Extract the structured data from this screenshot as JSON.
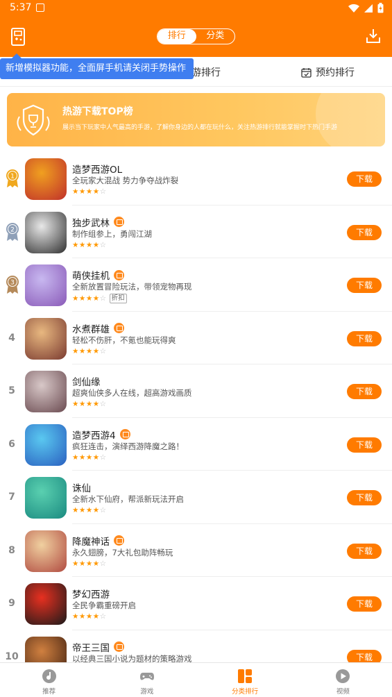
{
  "status_bar": {
    "time": "5:37"
  },
  "header": {
    "segments": [
      {
        "label": "排行",
        "active": true
      },
      {
        "label": "分类",
        "active": false
      }
    ]
  },
  "tabs": {
    "left_partial": "游排行",
    "right": "预约排行"
  },
  "tooltip": "新增模拟器功能，全面屏手机请关闭手势操作",
  "banner": {
    "title": "热游下载TOP榜",
    "desc": "展示当下玩家中人气最高的手游，了解你身边的人都在玩什么，关注热游排行就能掌握时下热门手游"
  },
  "download_label": "下载",
  "games": [
    {
      "rank": "1",
      "name": "造梦西游OL",
      "desc": "全玩家大混战 势力争夺战炸裂",
      "stars": 4,
      "gift": false,
      "tag": "",
      "colors": [
        "#f0a020",
        "#c0302a"
      ]
    },
    {
      "rank": "2",
      "name": "独步武林",
      "desc": "制作组参上，勇闯江湖",
      "stars": 4,
      "gift": true,
      "tag": "",
      "colors": [
        "#e8e8e8",
        "#303030"
      ]
    },
    {
      "rank": "3",
      "name": "萌侠挂机",
      "desc": "全新放置冒险玩法，带领宠物再现",
      "stars": 4,
      "gift": true,
      "tag": "折扣",
      "colors": [
        "#c8b8f0",
        "#8a5ab8"
      ]
    },
    {
      "rank": "4",
      "name": "水煮群雄",
      "desc": "轻松不伤肝，不氪也能玩得爽",
      "stars": 4,
      "gift": true,
      "tag": "",
      "colors": [
        "#e8b880",
        "#7a3a30"
      ]
    },
    {
      "rank": "5",
      "name": "剑仙缘",
      "desc": "超爽仙侠多人在线，超高游戏画质",
      "stars": 4,
      "gift": false,
      "tag": "",
      "colors": [
        "#d8c8c8",
        "#6a4a50"
      ]
    },
    {
      "rank": "6",
      "name": "造梦西游4",
      "desc": "疯狂连击，演绎西游降魔之路！",
      "stars": 4,
      "gift": true,
      "tag": "",
      "colors": [
        "#5ac8f0",
        "#2a60c0"
      ]
    },
    {
      "rank": "7",
      "name": "诛仙",
      "desc": "全新水下仙府，帮派新玩法开启",
      "stars": 4,
      "gift": false,
      "tag": "",
      "colors": [
        "#5ad0b0",
        "#1a8a80"
      ]
    },
    {
      "rank": "8",
      "name": "降魔神话",
      "desc": "永久翅膀，7大礼包助阵畅玩",
      "stars": 4,
      "gift": true,
      "tag": "",
      "colors": [
        "#f0d0a0",
        "#b04a40"
      ]
    },
    {
      "rank": "9",
      "name": "梦幻西游",
      "desc": "全民争霸重磅开启",
      "stars": 4,
      "gift": false,
      "tag": "",
      "colors": [
        "#e83020",
        "#1a1a1a"
      ]
    },
    {
      "rank": "10",
      "name": "帝王三国",
      "desc": "以经典三国小说为题材的策略游戏",
      "stars": 4,
      "gift": true,
      "tag": "",
      "colors": [
        "#d08040",
        "#402010"
      ]
    }
  ],
  "bottom_nav": [
    {
      "label": "推荐",
      "icon": "recommend-icon",
      "active": false
    },
    {
      "label": "游戏",
      "icon": "gamepad-icon",
      "active": false
    },
    {
      "label": "分类排行",
      "icon": "category-rank-icon",
      "active": true
    },
    {
      "label": "视频",
      "icon": "play-icon",
      "active": false
    }
  ],
  "colors": {
    "accent": "#ff7b00",
    "tooltip": "#3f7ef0",
    "gold": "#f0a81e",
    "silver": "#8fa0b8",
    "bronze": "#b58a5a"
  }
}
